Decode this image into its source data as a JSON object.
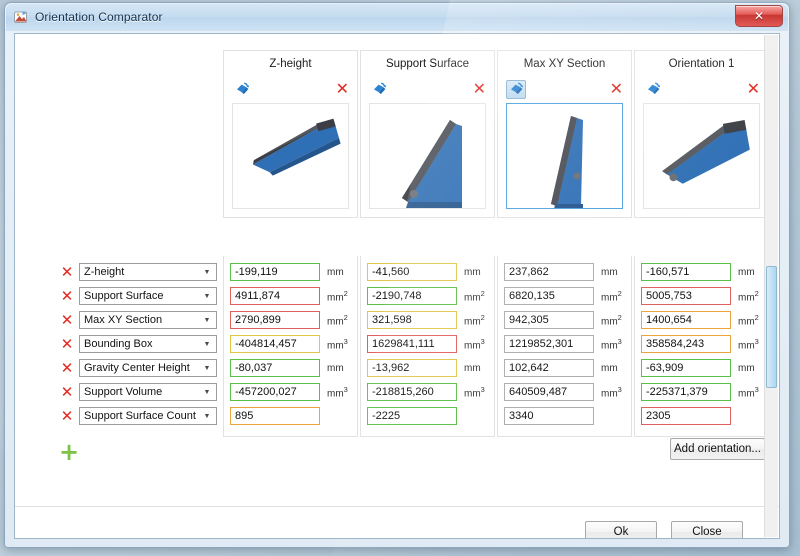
{
  "window": {
    "title": "Orientation Comparator",
    "icon": "app-icon",
    "close_label": "✕"
  },
  "columns": [
    {
      "title": "Z-height",
      "rotate_icon": "rotate-view-icon",
      "rotate_active": false,
      "remove_icon": "✕",
      "thumbnail_selected": false,
      "values": [
        {
          "value": "-199,119",
          "unit": "mm",
          "sup": "",
          "state": "green"
        },
        {
          "value": "4911,874",
          "unit": "mm",
          "sup": "2",
          "state": "red"
        },
        {
          "value": "2790,899",
          "unit": "mm",
          "sup": "2",
          "state": "red"
        },
        {
          "value": "-404814,457",
          "unit": "mm",
          "sup": "3",
          "state": "yellow"
        },
        {
          "value": "-80,037",
          "unit": "mm",
          "sup": "",
          "state": "green"
        },
        {
          "value": "-457200,027",
          "unit": "mm",
          "sup": "3",
          "state": "green"
        },
        {
          "value": "895",
          "unit": "",
          "sup": "",
          "state": "orange"
        }
      ]
    },
    {
      "title": "Support Surface",
      "rotate_icon": "rotate-view-icon",
      "rotate_active": false,
      "remove_icon": "✕",
      "thumbnail_selected": false,
      "values": [
        {
          "value": "-41,560",
          "unit": "mm",
          "sup": "",
          "state": "yellow"
        },
        {
          "value": "-2190,748",
          "unit": "mm",
          "sup": "2",
          "state": "green"
        },
        {
          "value": "321,598",
          "unit": "mm",
          "sup": "2",
          "state": "yellow"
        },
        {
          "value": "1629841,111",
          "unit": "mm",
          "sup": "3",
          "state": "red"
        },
        {
          "value": "-13,962",
          "unit": "mm",
          "sup": "",
          "state": "yellow"
        },
        {
          "value": "-218815,260",
          "unit": "mm",
          "sup": "3",
          "state": "green"
        },
        {
          "value": "-2225",
          "unit": "",
          "sup": "",
          "state": "green"
        }
      ]
    },
    {
      "title": "Max XY Section",
      "rotate_icon": "rotate-view-icon",
      "rotate_active": true,
      "remove_icon": "✕",
      "thumbnail_selected": true,
      "values": [
        {
          "value": "237,862",
          "unit": "mm",
          "sup": "",
          "state": "gray"
        },
        {
          "value": "6820,135",
          "unit": "mm",
          "sup": "2",
          "state": "gray"
        },
        {
          "value": "942,305",
          "unit": "mm",
          "sup": "2",
          "state": "gray"
        },
        {
          "value": "1219852,301",
          "unit": "mm",
          "sup": "3",
          "state": "gray"
        },
        {
          "value": "102,642",
          "unit": "mm",
          "sup": "",
          "state": "gray"
        },
        {
          "value": "640509,487",
          "unit": "mm",
          "sup": "3",
          "state": "gray"
        },
        {
          "value": "3340",
          "unit": "",
          "sup": "",
          "state": "gray"
        }
      ]
    },
    {
      "title": "Orientation 1",
      "rotate_icon": "rotate-view-icon",
      "rotate_active": false,
      "remove_icon": "✕",
      "thumbnail_selected": false,
      "values": [
        {
          "value": "-160,571",
          "unit": "mm",
          "sup": "",
          "state": "green"
        },
        {
          "value": "5005,753",
          "unit": "mm",
          "sup": "2",
          "state": "red"
        },
        {
          "value": "1400,654",
          "unit": "mm",
          "sup": "2",
          "state": "orange"
        },
        {
          "value": "358584,243",
          "unit": "mm",
          "sup": "3",
          "state": "orange"
        },
        {
          "value": "-63,909",
          "unit": "mm",
          "sup": "",
          "state": "green"
        },
        {
          "value": "-225371,379",
          "unit": "mm",
          "sup": "3",
          "state": "green"
        },
        {
          "value": "2305",
          "unit": "",
          "sup": "",
          "state": "red"
        }
      ]
    }
  ],
  "parameters": [
    {
      "label": "Z-height",
      "delete_icon": "✕",
      "arrow": "▼"
    },
    {
      "label": "Support Surface",
      "delete_icon": "✕",
      "arrow": "▼"
    },
    {
      "label": "Max XY Section",
      "delete_icon": "✕",
      "arrow": "▼"
    },
    {
      "label": "Bounding Box",
      "delete_icon": "✕",
      "arrow": "▼"
    },
    {
      "label": "Gravity Center Height",
      "delete_icon": "✕",
      "arrow": "▼"
    },
    {
      "label": "Support Volume",
      "delete_icon": "✕",
      "arrow": "▼"
    },
    {
      "label": "Support Surface Count",
      "delete_icon": "✕",
      "arrow": "▼"
    }
  ],
  "add_parameter": {
    "icon": "plus-icon",
    "label": "+"
  },
  "buttons": {
    "add_orientation": "Add orientation...",
    "ok": "Ok",
    "close": "Close"
  },
  "colors": {
    "accent_blue": "#2b83d4",
    "good_green": "#5cbf4a",
    "bad_red": "#e06060",
    "warn_yellow": "#e0c84a",
    "warn_orange": "#eba53c",
    "neutral_gray": "#adadad",
    "title_close": "#c52b27"
  }
}
